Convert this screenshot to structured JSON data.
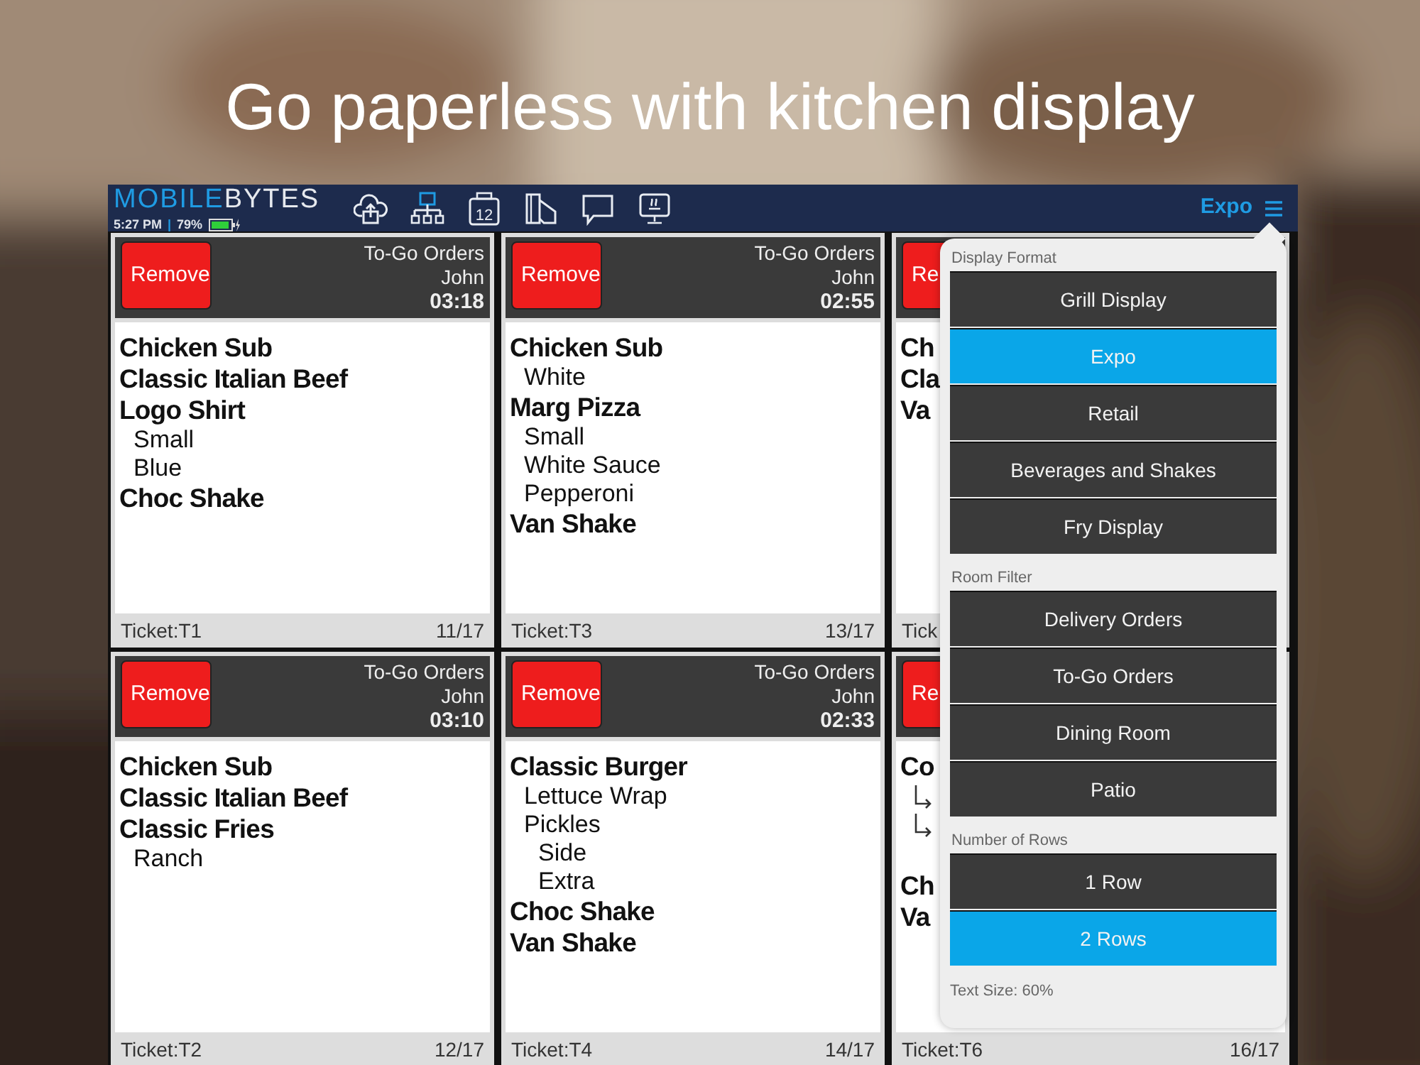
{
  "headline": "Go paperless with kitchen display",
  "app": {
    "logo": [
      "MOBILE",
      "BYTES"
    ],
    "time": "5:27 PM",
    "separator": "|",
    "battery": "79%",
    "toolbar": [
      {
        "kind": "cloud"
      },
      {
        "kind": "network"
      },
      {
        "kind": "calendar",
        "label": "12"
      },
      {
        "kind": "cards"
      },
      {
        "kind": "chat"
      },
      {
        "kind": "monitor"
      }
    ],
    "mode": "Expo"
  },
  "tickets": [
    {
      "remove": "Remove",
      "room": "To-Go Orders",
      "server": "John",
      "time": "03:18",
      "items": [
        {
          "kind": "item",
          "text": "Chicken Sub"
        },
        {
          "kind": "item",
          "text": "Classic Italian Beef"
        },
        {
          "kind": "item",
          "text": "Logo Shirt"
        },
        {
          "kind": "modifier",
          "text": "Small"
        },
        {
          "kind": "modifier",
          "text": "Blue"
        },
        {
          "kind": "item",
          "text": "Choc Shake"
        }
      ],
      "ticket": "Ticket:T1",
      "count": "11/17"
    },
    {
      "remove": "Remove",
      "room": "To-Go Orders",
      "server": "John",
      "time": "02:55",
      "items": [
        {
          "kind": "item",
          "text": "Chicken Sub"
        },
        {
          "kind": "modifier",
          "text": "White"
        },
        {
          "kind": "item",
          "text": "Marg Pizza"
        },
        {
          "kind": "modifier",
          "text": "Small"
        },
        {
          "kind": "modifier",
          "text": "White Sauce"
        },
        {
          "kind": "modifier",
          "text": "Pepperoni"
        },
        {
          "kind": "item",
          "text": "Van Shake"
        }
      ],
      "ticket": "Ticket:T3",
      "count": "13/17"
    },
    {
      "remove": "Re",
      "items": [
        {
          "kind": "item",
          "text": "Ch"
        },
        {
          "kind": "item",
          "text": "Cla"
        },
        {
          "kind": "item",
          "text": "Va"
        }
      ],
      "ticket": "Tick"
    },
    {
      "remove": "Remove",
      "room": "To-Go Orders",
      "server": "John",
      "time": "03:10",
      "items": [
        {
          "kind": "item",
          "text": "Chicken Sub"
        },
        {
          "kind": "item",
          "text": "Classic Italian Beef"
        },
        {
          "kind": "item",
          "text": "Classic Fries"
        },
        {
          "kind": "modifier",
          "text": "Ranch"
        }
      ],
      "ticket": "Ticket:T2",
      "count": "12/17"
    },
    {
      "remove": "Remove",
      "room": "To-Go Orders",
      "server": "John",
      "time": "02:33",
      "items": [
        {
          "kind": "item",
          "text": "Classic Burger"
        },
        {
          "kind": "modifier",
          "text": "Lettuce Wrap"
        },
        {
          "kind": "modifier",
          "text": "Pickles"
        },
        {
          "kind": "submodifier",
          "text": "Side"
        },
        {
          "kind": "submodifier",
          "text": "Extra"
        },
        {
          "kind": "item",
          "text": "Choc Shake"
        },
        {
          "kind": "item",
          "text": "Van Shake"
        }
      ],
      "ticket": "Ticket:T4",
      "count": "14/17"
    },
    {
      "remove": "Re",
      "items": [
        {
          "kind": "item",
          "text": "Co"
        },
        {
          "kind": "arrow"
        },
        {
          "kind": "arrow"
        },
        {
          "kind": "item",
          "text": "Ch",
          "spaced": true
        },
        {
          "kind": "item",
          "text": "Va"
        }
      ],
      "ticket": "Ticket:T6",
      "count": "16/17"
    }
  ],
  "popover": {
    "sections": [
      {
        "title": "Display Format",
        "options": [
          {
            "label": "Grill Display",
            "selected": false
          },
          {
            "label": "Expo",
            "selected": true
          },
          {
            "label": "Retail",
            "selected": false
          },
          {
            "label": "Beverages and Shakes",
            "selected": false
          },
          {
            "label": "Fry Display",
            "selected": false
          }
        ]
      },
      {
        "title": "Room Filter",
        "options": [
          {
            "label": "Delivery Orders",
            "selected": false
          },
          {
            "label": "To-Go Orders",
            "selected": false
          },
          {
            "label": "Dining Room",
            "selected": false
          },
          {
            "label": "Patio",
            "selected": false
          }
        ]
      },
      {
        "title": "Number of Rows",
        "options": [
          {
            "label": "1 Row",
            "selected": false
          },
          {
            "label": "2 Rows",
            "selected": true
          }
        ]
      }
    ],
    "footer": "Text Size: 60%"
  }
}
